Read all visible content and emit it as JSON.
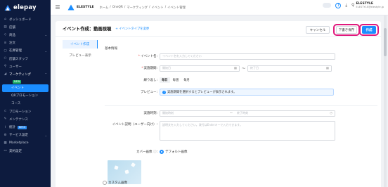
{
  "app": {
    "brand": "elepay"
  },
  "sidebar": {
    "items": [
      {
        "label": "ダッシュボード",
        "icon": "home-icon"
      },
      {
        "label": "店舗",
        "icon": "store-icon"
      },
      {
        "label": "商品",
        "icon": "tag-icon",
        "expandable": true
      },
      {
        "label": "注文",
        "icon": "list-icon"
      },
      {
        "label": "在庫管理",
        "icon": "box-icon",
        "expandable": true
      },
      {
        "label": "店舗スタッフ",
        "icon": "staff-icon"
      },
      {
        "label": "ユーザー",
        "icon": "user-icon"
      },
      {
        "label": "マーケティング",
        "icon": "megaphone-icon",
        "expandable": true,
        "open": true,
        "badge": "NEW"
      },
      {
        "label": "イベント",
        "active": true,
        "sub": true
      },
      {
        "label": "QRプロモーション",
        "sub": true
      },
      {
        "label": "コース",
        "sub": true
      },
      {
        "label": "プロモーション",
        "icon": "promo-icon"
      },
      {
        "label": "メンテナンス",
        "icon": "wrench-icon"
      },
      {
        "label": "統計",
        "icon": "chart-icon",
        "badge": "BETA"
      },
      {
        "label": "サービス設定",
        "icon": "gear-icon",
        "expandable": true
      },
      {
        "label": "Marketplace",
        "icon": "grid-icon"
      },
      {
        "label": "契約設定",
        "icon": "doc-icon"
      }
    ]
  },
  "topbar": {
    "org_name": "ELESTYLE",
    "breadcrumb": [
      "ホーム",
      "/",
      "OneQR",
      "/",
      "マーケティング",
      "/",
      "イベント",
      "/",
      "イベント管理"
    ],
    "user_name": "ELESTYLE",
    "user_email": "ELESTYLE@elestyle.jp"
  },
  "page": {
    "title": "イベント作成：動画視聴",
    "change_type_link": "+ イベントタイプを変更",
    "cancel_label": "キャンセル",
    "draft_label": "下書き保存",
    "create_label": "作成"
  },
  "tabs": [
    {
      "label": "イベント作成",
      "active": true
    },
    {
      "label": "プレビュー表示",
      "active": false
    }
  ],
  "form": {
    "section_title": "基本情報",
    "event_name_label": "イベント名",
    "event_name_placeholder": "イベント名を入力してください",
    "period_label": "実施期間",
    "start_placeholder": "開始日",
    "end_placeholder": "終了日",
    "period_separator": "～",
    "repeat_label": "繰り返し",
    "repeat_options": [
      "毎日",
      "毎週",
      "毎月"
    ],
    "repeat_selected": "毎日",
    "preview_label": "プレビュー",
    "preview_text": "実施期間を選択するとプレビューが表示されます。",
    "time_label": "実施時刻",
    "start_time_placeholder": "開始時刻",
    "end_time_placeholder": "終了時刻",
    "time_separator": "～",
    "desc_label": "イベント説明（ユーザー向け）",
    "desc_placeholder": "説明文を入力してください。改行はEnterキーで入力できます。",
    "cover_label": "カバー画像",
    "cover_default": "デフォルト画像",
    "cover_custom": "カスタム画像"
  },
  "colors": {
    "sidebar_bg": "#0d1b3e",
    "accent": "#1a8dff",
    "highlight": "#e0197d"
  }
}
